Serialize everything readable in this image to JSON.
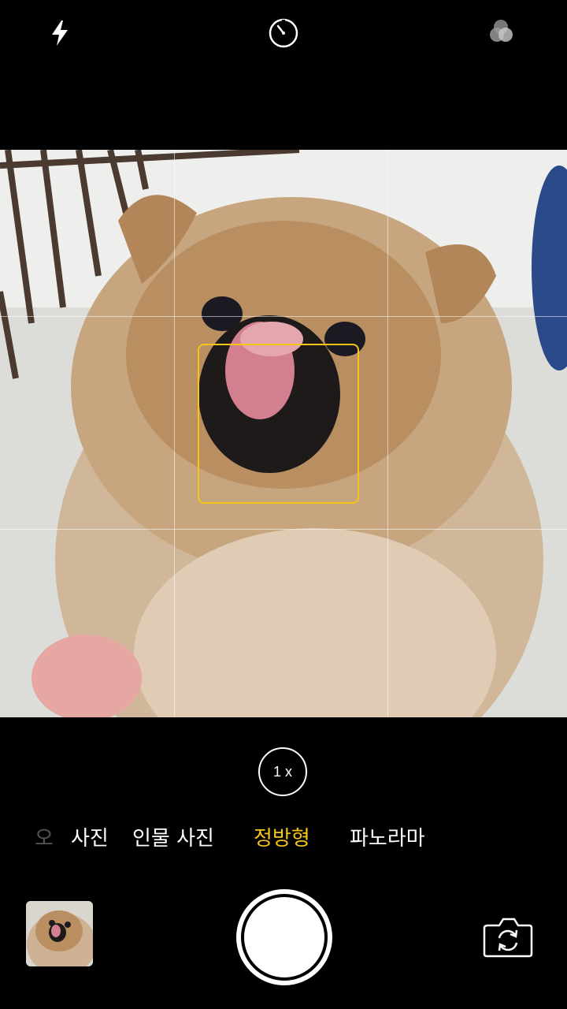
{
  "top_bar": {
    "icons": [
      "flash-icon",
      "timer-icon",
      "filters-icon"
    ]
  },
  "viewfinder": {
    "grid": "3x3",
    "focus_box_color": "#f5c518"
  },
  "zoom": {
    "label": "1 x"
  },
  "modes": {
    "items": [
      "오",
      "사진",
      "인물 사진",
      "정방형",
      "파노라마"
    ],
    "selected": "정방형",
    "selected_color": "#f5c518"
  },
  "controls": {
    "icons": [
      "shutter-button",
      "flip-camera-icon",
      "last-photo-thumbnail"
    ]
  }
}
